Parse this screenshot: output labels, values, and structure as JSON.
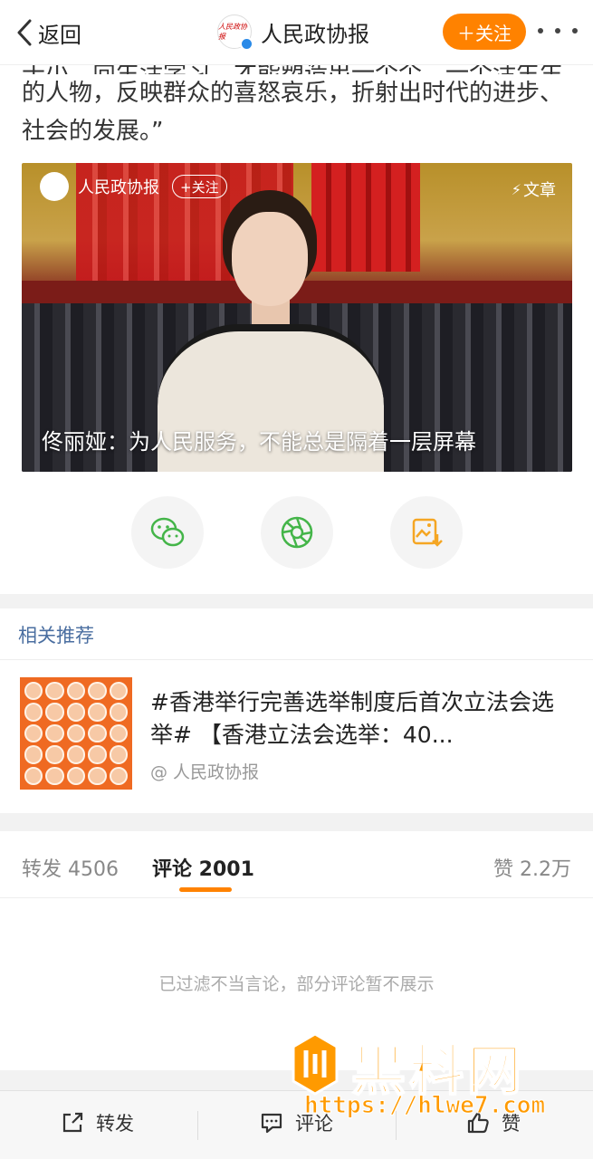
{
  "header": {
    "back_label": "返回",
    "title": "人民政协报",
    "avatar_text": "人民政协报",
    "follow_label": "＋关注"
  },
  "article": {
    "cut_line": "于小、向生活学习，才能塑造出一个个、一个活生生",
    "paragraph": "的人物，反映群众的喜怒哀乐，折射出时代的进步、社会的发展。”"
  },
  "card": {
    "account": "人民政协报",
    "follow_label": "+关注",
    "type_label": "文章",
    "caption": "佟丽娅：为人民服务，不能总是隔着一层屏幕"
  },
  "share": {
    "icons": [
      "wechat-icon",
      "moments-icon",
      "save-image-icon"
    ],
    "colors": {
      "wechat": "#44b549",
      "moments": "#44b549",
      "save": "#f5a623"
    }
  },
  "recommend": {
    "title": "相关推荐",
    "item_text": "#香港举行完善选举制度后首次立法会选举# 【香港立法会选举：40...",
    "item_source": "@ 人民政协报"
  },
  "tabs": {
    "repost": "转发 4506",
    "comment": "评论 2001",
    "like": "赞 2.2万"
  },
  "comments": {
    "filter_note": "已过滤不当言论，部分评论暂不展示"
  },
  "bottom_bar": {
    "repost": "转发",
    "comment": "评论",
    "like": "赞"
  },
  "watermark": {
    "text": "黑料网",
    "url": "https://hlwe7.com"
  },
  "colors": {
    "accent": "#ff8200",
    "link": "#4a6ea0",
    "verified": "#2a8ae8"
  }
}
